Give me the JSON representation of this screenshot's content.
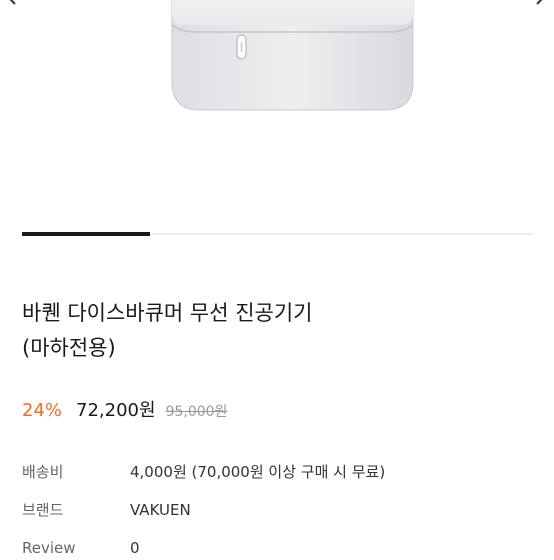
{
  "product": {
    "title_line1": "바퀜 다이스바큐머 무선 진공기기",
    "title_line2": "(마하전용)",
    "discount": "24%",
    "price": "72,200원",
    "original_price": "95,000원"
  },
  "details": [
    {
      "label": "배송비",
      "value": "4,000원 (70,000원 이상 구매 시 무료)"
    },
    {
      "label": "브랜드",
      "value": "VAKUEN"
    },
    {
      "label": "Review",
      "value": "0"
    }
  ],
  "gallery": {
    "current_index": 1,
    "total": 4
  },
  "colors": {
    "accent": "#ef6c2a",
    "text": "#1a1a1a",
    "muted": "#9a9a9a",
    "label": "#666666"
  },
  "icons": {
    "prev": "chevron-left-icon",
    "next": "chevron-right-icon"
  }
}
